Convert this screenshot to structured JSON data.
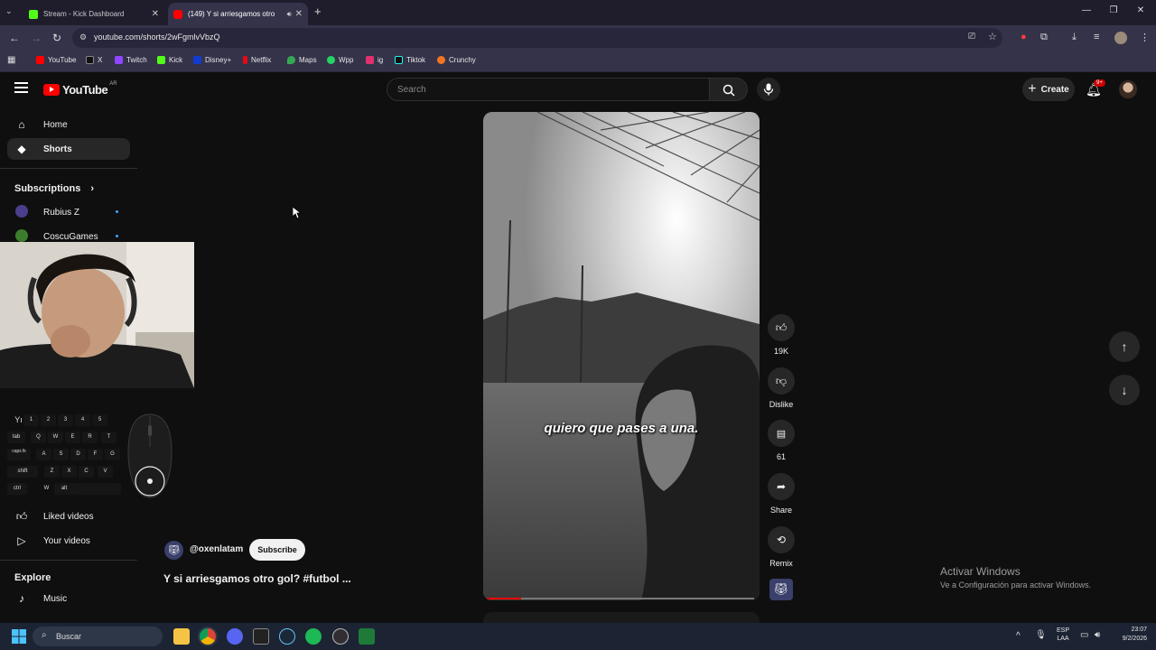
{
  "browser": {
    "tabs": [
      {
        "title": "Stream - Kick Dashboard",
        "favicon_color": "#53fc18",
        "active": false
      },
      {
        "title": "(149) Y si arriesgamos otro",
        "favicon_color": "#ff0000",
        "active": true
      }
    ],
    "url": "youtube.com/shorts/2wFgmlvVbzQ",
    "bookmarks": [
      {
        "label": "YouTube",
        "color": "#ff0000"
      },
      {
        "label": "X",
        "color": "#222222"
      },
      {
        "label": "Twitch",
        "color": "#9146ff"
      },
      {
        "label": "Kick",
        "color": "#53fc18"
      },
      {
        "label": "Disney+",
        "color": "#113ccf"
      },
      {
        "label": "Netflix",
        "color": "#e50914"
      },
      {
        "label": "Maps",
        "color": "#34a853"
      },
      {
        "label": "Wpp",
        "color": "#25d366"
      },
      {
        "label": "ig",
        "color": "#e1306c"
      },
      {
        "label": "Tiktok",
        "color": "#111111"
      },
      {
        "label": "Crunchy",
        "color": "#f47521"
      }
    ]
  },
  "youtube": {
    "logo_text": "YouTube",
    "country_code": "AR",
    "search_placeholder": "Search",
    "create_label": "Create",
    "notification_count": "9+",
    "sidebar": {
      "home": "Home",
      "shorts": "Shorts",
      "subscriptions_header": "Subscriptions",
      "subscriptions": [
        "Rubius Z",
        "CoscuGames"
      ],
      "liked_videos": "Liked videos",
      "your_videos": "Your videos",
      "explore_header": "Explore",
      "music": "Music"
    },
    "short": {
      "caption": "quiero que pases a una.",
      "channel": "@oxenlatam",
      "subscribe_label": "Subscribe",
      "title": "Y si arriesgamos otro gol? #futbol ...",
      "likes": "19K",
      "dislike_label": "Dislike",
      "comments": "61",
      "share_label": "Share",
      "remix_label": "Remix"
    }
  },
  "keyboard_overlay": {
    "row1": [
      "Yı",
      "1",
      "2",
      "3",
      "4",
      "5"
    ],
    "row2": [
      "tab",
      "Q",
      "W",
      "E",
      "R",
      "T"
    ],
    "row3": [
      "caps lk",
      "A",
      "S",
      "D",
      "F",
      "G"
    ],
    "row4": [
      "shift",
      "Z",
      "X",
      "C",
      "V"
    ],
    "row5": [
      "ctrl",
      "W",
      "alt"
    ]
  },
  "windows": {
    "activate_title": "Activar Windows",
    "activate_sub": "Ve a Configuración para activar Windows.",
    "search_label": "Buscar",
    "lang_1": "ESP",
    "lang_2": "LAA",
    "time": "23:07",
    "date": "9/2/2026"
  }
}
